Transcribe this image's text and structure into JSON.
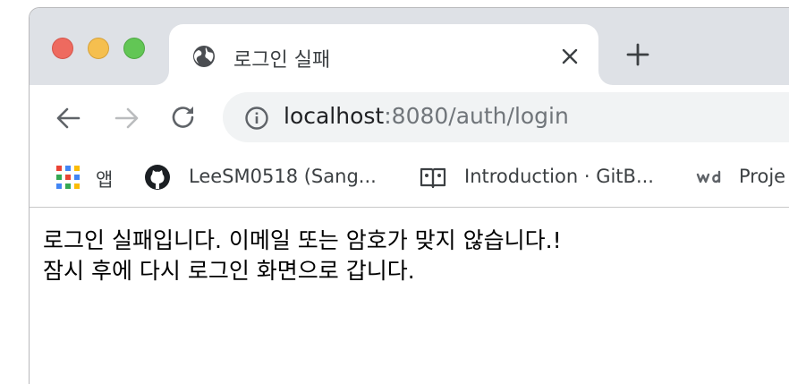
{
  "tab": {
    "title": "로그인 실패",
    "favicon": "globe-icon"
  },
  "toolbar": {
    "url_host": "localhost",
    "url_rest": ":8080/auth/login"
  },
  "bookmarks": [
    {
      "label": "앱",
      "icon": "apps-grid-icon"
    },
    {
      "label": "LeeSM0518 (Sang...",
      "icon": "github-icon"
    },
    {
      "label": "Introduction · GitB...",
      "icon": "gitbook-icon"
    },
    {
      "label": "Proje",
      "icon": "wd-logo-icon"
    }
  ],
  "page": {
    "line1": "로그인 실패입니다. 이메일 또는 암호가 맞지 않습니다.!",
    "line2": "잠시 후에 다시 로그인 화면으로 갑니다."
  },
  "colors": {
    "tabstrip": "#dee1e6",
    "omnibox": "#f1f3f4",
    "close": "#ee6a5f",
    "minimize": "#f5bf4f",
    "maximize": "#62c655"
  }
}
